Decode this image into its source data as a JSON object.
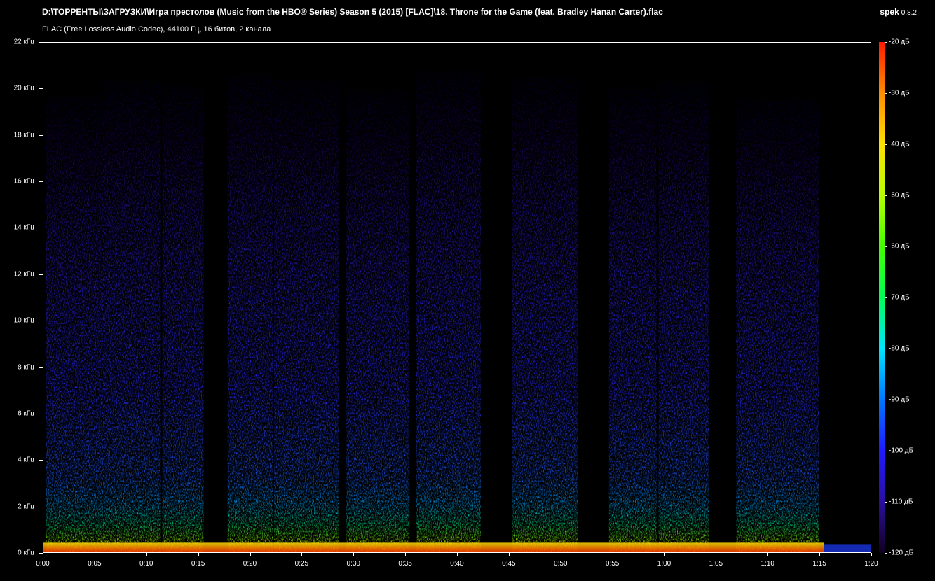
{
  "header": {
    "file_path": "D:\\ТОРРЕНТЫ\\ЗАГРУЗКИ\\Игра престолов (Music from the HBO® Series) Season 5 (2015) [FLAC]\\18. Throne for the Game (feat. Bradley Hanan Carter).flac",
    "file_info": "FLAC (Free Lossless Audio Codec), 44100 Гц, 16 битов, 2 канала",
    "app_name": "spek",
    "app_version": "0.8.2"
  },
  "y_axis": {
    "labels": [
      "22 кГц",
      "20 кГц",
      "18 кГц",
      "16 кГц",
      "14 кГц",
      "12 кГц",
      "10 кГц",
      "8 кГц",
      "6 кГц",
      "4 кГц",
      "2 кГц",
      "0 кГц"
    ]
  },
  "x_axis": {
    "labels": [
      "0:00",
      "0:05",
      "0:10",
      "0:15",
      "0:20",
      "0:25",
      "0:30",
      "0:35",
      "0:40",
      "0:45",
      "0:50",
      "0:55",
      "1:00",
      "1:05",
      "1:10",
      "1:15",
      "1:20"
    ]
  },
  "colorbar": {
    "labels": [
      "-20 дБ",
      "-30 дБ",
      "-40 дБ",
      "-50 дБ",
      "-60 дБ",
      "-70 дБ",
      "-80 дБ",
      "-90 дБ",
      "-100 дБ",
      "-110 дБ",
      "-120 дБ"
    ],
    "colors": [
      "#ff1a00",
      "#ff8c00",
      "#ffe000",
      "#b8ff00",
      "#44ff00",
      "#00ff55",
      "#00e5ff",
      "#0077ff",
      "#1f1aff",
      "#2b0fa0",
      "#120020"
    ]
  },
  "spectrogram": {
    "duration_seconds": 80,
    "max_khz": 22,
    "segments": [
      {
        "start": 0.2,
        "end": 5.8,
        "level": 0.78
      },
      {
        "start": 5.8,
        "end": 11.3,
        "level": 0.9
      },
      {
        "start": 11.5,
        "end": 15.5,
        "level": 0.86
      },
      {
        "start": 17.8,
        "end": 22.2,
        "level": 0.95
      },
      {
        "start": 22.3,
        "end": 28.6,
        "level": 0.9
      },
      {
        "start": 29.3,
        "end": 35.4,
        "level": 0.82
      },
      {
        "start": 36.0,
        "end": 42.3,
        "level": 0.98
      },
      {
        "start": 45.3,
        "end": 51.7,
        "level": 0.92
      },
      {
        "start": 54.7,
        "end": 59.3,
        "level": 0.85
      },
      {
        "start": 59.5,
        "end": 64.4,
        "level": 0.88
      },
      {
        "start": 67.0,
        "end": 75.0,
        "level": 0.75
      }
    ]
  }
}
